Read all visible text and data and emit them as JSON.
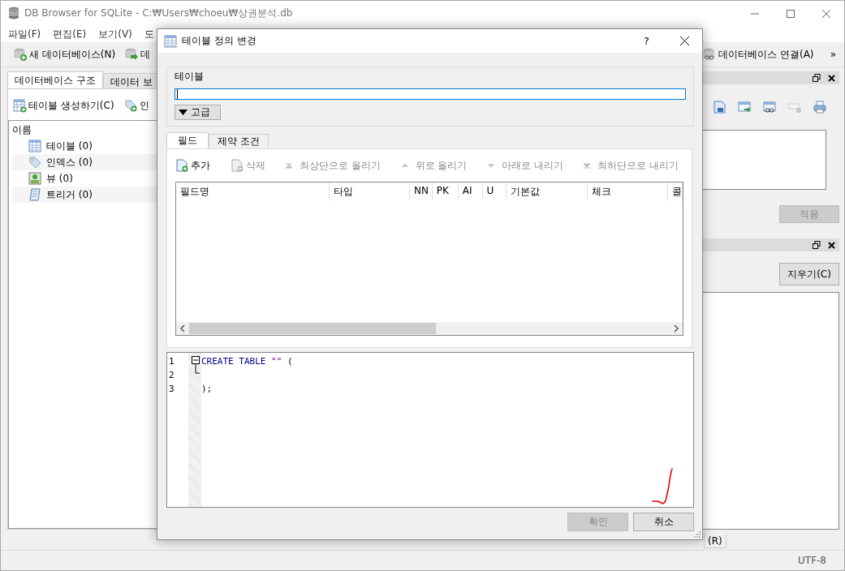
{
  "main_window": {
    "title": "DB Browser for SQLite - C:₩Users₩choeu₩상권분석.db"
  },
  "menu": [
    "파일(F)",
    "편집(E)",
    "보기(V)",
    "도"
  ],
  "toolbar": [
    {
      "label": "새 데이터베이스(N)",
      "kind": "new"
    },
    {
      "label": "데",
      "kind": "open"
    },
    {
      "label": "데이터베이스 연결(A)",
      "kind": "attach"
    }
  ],
  "toolbar_overflow": "»",
  "left_tabs": [
    {
      "label": "데이터베이스 구조",
      "selected": true
    },
    {
      "label": "데이터 보",
      "selected": false
    }
  ],
  "structure_actions": [
    {
      "label": "테이블 생성하기(C)",
      "kind": "table"
    },
    {
      "label": "인",
      "kind": "index"
    }
  ],
  "tree": {
    "header": "이름",
    "items": [
      {
        "label": "테이블 (0)",
        "kind": "table"
      },
      {
        "label": "인덱스 (0)",
        "kind": "index"
      },
      {
        "label": "뷰 (0)",
        "kind": "view"
      },
      {
        "label": "트리거 (0)",
        "kind": "trigger"
      }
    ]
  },
  "right_dock": {
    "apply_button": {
      "label": "적용",
      "disabled": true
    },
    "clear_button": {
      "label": "지우기(C)",
      "disabled": false
    }
  },
  "bottom_tabs": [
    "(R)"
  ],
  "status_bar": {
    "encoding": "UTF-8"
  },
  "dialog": {
    "title": "테이블 정의 변경",
    "help": "?",
    "table_group": {
      "label": "테이블"
    },
    "advanced_button": {
      "label": "고급",
      "expanded": false
    },
    "tabs": [
      {
        "label": "필드",
        "selected": true
      },
      {
        "label": "제약 조건",
        "selected": false
      }
    ],
    "field_toolbar": [
      {
        "label": "추가",
        "kind": "add",
        "disabled": false
      },
      {
        "label": "삭제",
        "kind": "remove",
        "disabled": true
      },
      {
        "label": "최상단으로 올리기",
        "kind": "top",
        "disabled": true
      },
      {
        "label": "위로 올리기",
        "kind": "up",
        "disabled": true
      },
      {
        "label": "아래로 내리기",
        "kind": "down",
        "disabled": true
      },
      {
        "label": "최하단으로 내리기",
        "kind": "bottom",
        "disabled": true
      }
    ],
    "columns": [
      "필드명",
      "타입",
      "NN",
      "PK",
      "AI",
      "U",
      "기본값",
      "체크",
      "콜"
    ],
    "sql_editor": {
      "lines": [
        {
          "number": "1",
          "tokens": [
            {
              "text": "CREATE TABLE",
              "kind": "keyword"
            },
            {
              "text": "\"\"",
              "kind": "string"
            },
            {
              "text": "(",
              "kind": "punct"
            }
          ]
        },
        {
          "number": "2"
        },
        {
          "number": "3",
          "tokens": [
            {
              "text": ");",
              "kind": "punct"
            }
          ]
        }
      ]
    },
    "buttons": [
      {
        "label": "확인",
        "disabled": true
      },
      {
        "label": "취소",
        "disabled": false
      }
    ]
  }
}
